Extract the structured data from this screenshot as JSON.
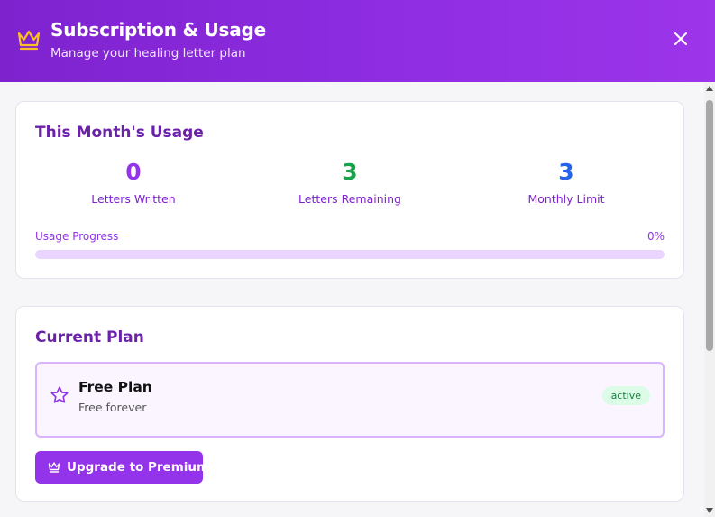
{
  "header": {
    "title": "Subscription & Usage",
    "subtitle": "Manage your healing letter plan",
    "icon": "crown-icon",
    "close_icon": "close-icon"
  },
  "usage": {
    "title": "This Month's Usage",
    "stats": [
      {
        "value": "0",
        "label": "Letters Written",
        "color": "#9333ea"
      },
      {
        "value": "3",
        "label": "Letters Remaining",
        "color": "#16a34a"
      },
      {
        "value": "3",
        "label": "Monthly Limit",
        "color": "#2563eb"
      }
    ],
    "progress_label": "Usage Progress",
    "progress_percent_text": "0%",
    "progress_fraction": 0
  },
  "plan": {
    "title": "Current Plan",
    "name": "Free Plan",
    "description": "Free forever",
    "icon": "star-icon",
    "badge": "active",
    "upgrade_label": "Upgrade to Premium",
    "upgrade_icon": "crown-icon"
  },
  "colors": {
    "header_gradient_start": "#7e22ce",
    "header_gradient_end": "#9d35ea",
    "accent": "#9333ea",
    "crown": "#fbbf24"
  }
}
